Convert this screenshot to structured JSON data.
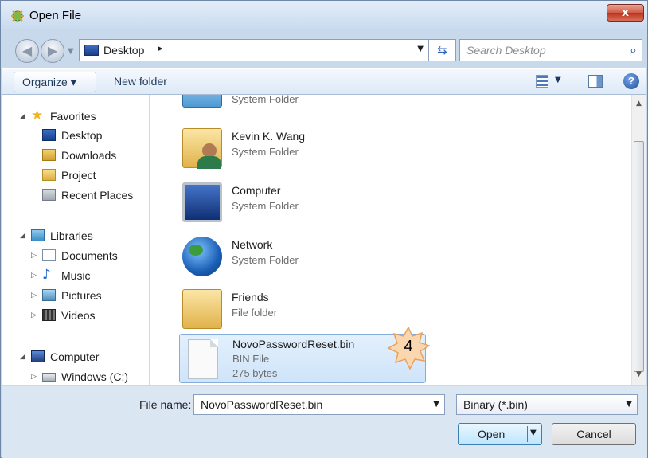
{
  "window": {
    "title": "Open File",
    "close_label": "x"
  },
  "address": {
    "location": "Desktop",
    "separator": "▸",
    "refresh_glyph": "⇆",
    "search_placeholder": "Search Desktop"
  },
  "toolbar": {
    "organize_label": "Organize ▾",
    "new_folder_label": "New folder",
    "help_glyph": "?"
  },
  "nav": {
    "favorites": {
      "label": "Favorites",
      "items": [
        "Desktop",
        "Downloads",
        "Project",
        "Recent Places"
      ]
    },
    "libraries": {
      "label": "Libraries",
      "items": [
        "Documents",
        "Music",
        "Pictures",
        "Videos"
      ]
    },
    "computer": {
      "label": "Computer",
      "items": [
        "Windows (C:)"
      ]
    }
  },
  "files": [
    {
      "name": "",
      "type": "System Folder",
      "icon": "library-folder-icon"
    },
    {
      "name": "Kevin K. Wang",
      "type": "System Folder",
      "icon": "user-folder-icon"
    },
    {
      "name": "Computer",
      "type": "System Folder",
      "icon": "computer-icon"
    },
    {
      "name": "Network",
      "type": "System Folder",
      "icon": "network-icon"
    },
    {
      "name": "Friends",
      "type": "File folder",
      "icon": "folder-icon"
    },
    {
      "name": "NovoPasswordReset.bin",
      "type": "BIN File",
      "size": "275 bytes",
      "icon": "bin-file-icon",
      "selected": true
    }
  ],
  "callout": {
    "number": "4",
    "color": "#f7c99a"
  },
  "bottom": {
    "file_name_label": "File name:",
    "file_name_value": "NovoPasswordReset.bin",
    "filter_value": "Binary (*.bin)",
    "open_label": "Open",
    "cancel_label": "Cancel"
  }
}
